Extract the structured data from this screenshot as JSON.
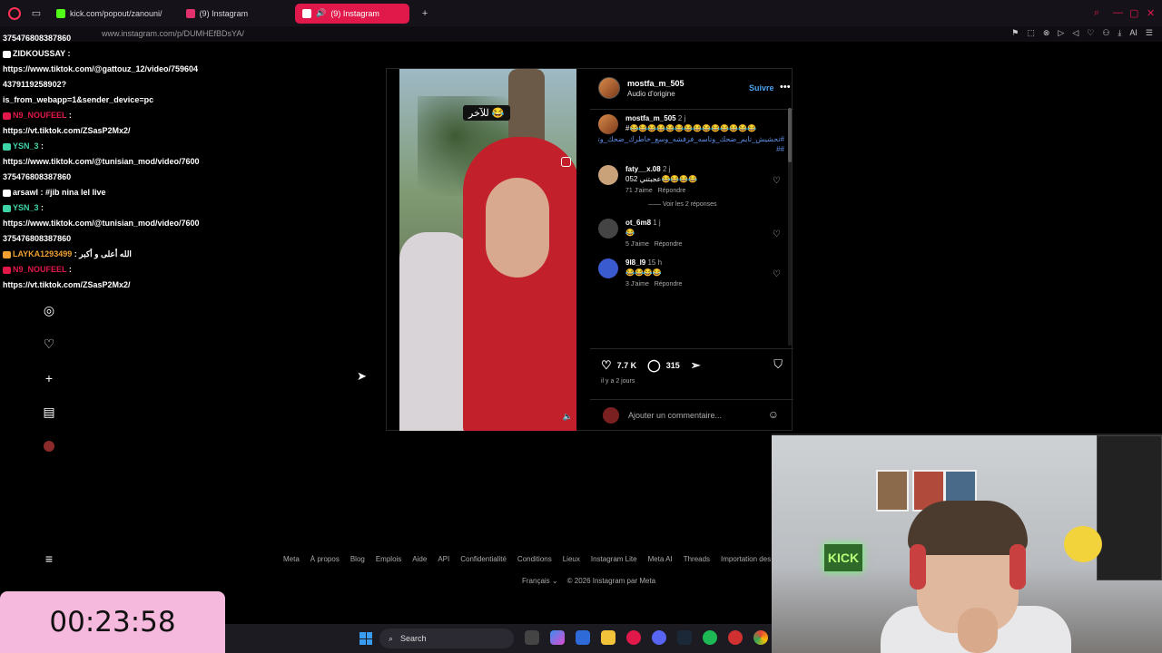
{
  "browser": {
    "tabs": [
      {
        "label": "kick.com/popout/zanouni/",
        "color": "#53fc18"
      },
      {
        "label": "(9) Instagram",
        "color": "#e1306c"
      },
      {
        "label": "(9) Instagram",
        "color": "#ffffff"
      }
    ],
    "url": "www.instagram.com/p/DUMHEfBDsYA/",
    "ai_label": "AI"
  },
  "chat": [
    {
      "user": "",
      "text": "375476808387860",
      "color": "#ffffff"
    },
    {
      "user": "ZIDKOUSSAY",
      "text": " :",
      "color": "#ffffff"
    },
    {
      "user": "",
      "text": "https://www.tiktok.com/@gattouz_12/video/759604",
      "color": "#ffffff"
    },
    {
      "user": "",
      "text": "4379119258902?",
      "color": "#ffffff"
    },
    {
      "user": "",
      "text": "is_from_webapp=1&sender_device=pc",
      "color": "#ffffff"
    },
    {
      "user": "N9_NOUFEEL",
      "text": " :",
      "color": "#e0194a"
    },
    {
      "user": "",
      "text": "https://vt.tiktok.com/ZSasP2Mx2/",
      "color": "#ffffff"
    },
    {
      "user": "YSN_3",
      "text": " :",
      "color": "#3fd4a8"
    },
    {
      "user": "",
      "text": "https://www.tiktok.com/@tunisian_mod/video/7600",
      "color": "#ffffff"
    },
    {
      "user": "",
      "text": "375476808387860",
      "color": "#ffffff"
    },
    {
      "user": "arsawl",
      "text": " : #jib nina lel live",
      "color": "#ffffff"
    },
    {
      "user": "YSN_3",
      "text": " :",
      "color": "#3fd4a8"
    },
    {
      "user": "",
      "text": "https://www.tiktok.com/@tunisian_mod/video/7600",
      "color": "#ffffff"
    },
    {
      "user": "",
      "text": "375476808387860",
      "color": "#ffffff"
    },
    {
      "user": "LAYKA1293499",
      "text": " : الله أعلى و أكبر",
      "color": "#f0a030"
    },
    {
      "user": "N9_NOUFEEL",
      "text": " :",
      "color": "#e0194a"
    },
    {
      "user": "",
      "text": "https://vt.tiktok.com/ZSasP2Mx2/",
      "color": "#ffffff"
    }
  ],
  "post": {
    "sticker": "للآخر 😂",
    "author": "mostfa_m_505",
    "audio": "Audio d'origine",
    "follow": "Suivre",
    "caption_time": "2 j",
    "caption_emojis": "#😂😂😂😂😂😂😂😂😂😂😂😂😂😂",
    "caption_tags": "#تحشيش_تايم_ضحك_وتاسه_فرفشه_وسع_خاطرك_ضحك_وتاسه_فله_اضحك_حتى_الموت_انبسط_فرفش ##",
    "comments": [
      {
        "user": "faty__x.08",
        "time": "2 j",
        "text": "عجبتني 052😂😂😂😂",
        "likes": "71 J'aime",
        "reply": "Répondre",
        "color": "#c9a27a"
      },
      {
        "user": "ot_6m8",
        "time": "1 j",
        "text": "😂",
        "likes": "5 J'aime",
        "reply": "Répondre",
        "color": "#444444"
      },
      {
        "user": "9l8_l9",
        "time": "15 h",
        "text": "😂😂😂😂",
        "likes": "3 J'aime",
        "reply": "Répondre",
        "color": "#3a5ad0"
      }
    ],
    "view_replies": "Voir les 2 réponses",
    "like_count": "7.7 K",
    "comment_count": "315",
    "ago": "il y a 2 jours",
    "comment_placeholder": "Ajouter un commentaire..."
  },
  "footer": {
    "links": [
      "Meta",
      "À propos",
      "Blog",
      "Emplois",
      "Aide",
      "API",
      "Confidentialité",
      "Conditions",
      "Lieux",
      "Instagram Lite",
      "Meta AI",
      "Threads",
      "Importation des conta"
    ],
    "language": "Français",
    "copyright": "© 2026 Instagram par Meta"
  },
  "timer": "00:23:58",
  "taskbar": {
    "search_label": "Search"
  },
  "webcam": {
    "sign": "KICK"
  }
}
